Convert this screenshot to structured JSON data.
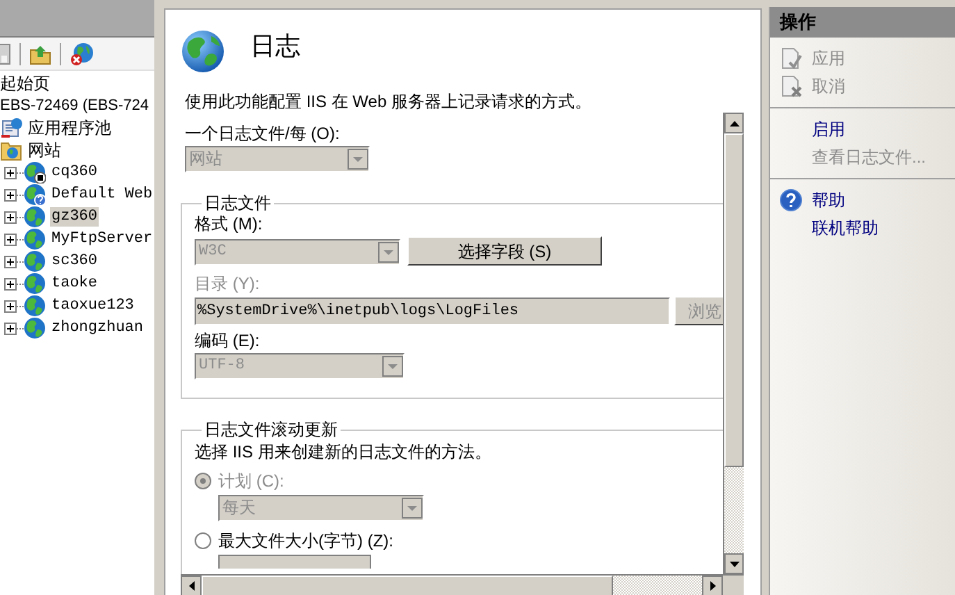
{
  "tree": [
    {
      "label": "起始页",
      "kind": "start",
      "selected": false
    },
    {
      "label": "EBS-72469 (EBS-724",
      "kind": "server",
      "selected": false,
      "children": [
        {
          "label": "应用程序池",
          "kind": "app_pools",
          "selected": false
        },
        {
          "label": "网站",
          "kind": "sites",
          "selected": false,
          "children": [
            {
              "label": "cq360",
              "kind": "stopped_site",
              "expanded": false,
              "selected": false
            },
            {
              "label": "Default Web",
              "kind": "unknown_site",
              "expanded": false,
              "selected": false
            },
            {
              "label": "gz360",
              "kind": "site",
              "expanded": false,
              "selected": true
            },
            {
              "label": "MyFtpServer",
              "kind": "site",
              "expanded": false,
              "selected": false
            },
            {
              "label": "sc360",
              "kind": "site",
              "expanded": false,
              "selected": false
            },
            {
              "label": "taoke",
              "kind": "site",
              "expanded": false,
              "selected": false
            },
            {
              "label": "taoxue123",
              "kind": "site",
              "expanded": false,
              "selected": false
            },
            {
              "label": "zhongzhuan",
              "kind": "site",
              "expanded": false,
              "selected": false
            }
          ]
        }
      ]
    }
  ],
  "feature": {
    "title": "日志",
    "description": "使用此功能配置 IIS 在 Web 服务器上记录请求的方式。",
    "log_file_per": {
      "label": "一个日志文件/每 (O):",
      "value": "网站",
      "disabled": true
    },
    "log_file": {
      "title": "日志文件",
      "format": {
        "label": "格式 (M):",
        "value": "W3C",
        "disabled": true
      },
      "select_fields_button": "选择字段 (S)",
      "directory": {
        "label": "目录 (Y):",
        "value": "%SystemDrive%\\inetpub\\logs\\LogFiles",
        "disabled": true
      },
      "browse_button": "浏览",
      "encoding": {
        "label": "编码 (E):",
        "value": "UTF-8",
        "disabled": true
      }
    },
    "rollover": {
      "title": "日志文件滚动更新",
      "description": "选择 IIS 用来创建新的日志文件的方法。",
      "options": [
        {
          "label": "计划 (C):",
          "selected": true,
          "disabled": true,
          "dropdown": "每天"
        },
        {
          "label": "最大文件大小(字节) (Z):",
          "selected": false,
          "disabled": false
        }
      ]
    }
  },
  "actions": {
    "title": "操作",
    "groups": [
      [
        {
          "label": "应用",
          "kind": "apply",
          "disabled": true
        },
        {
          "label": "取消",
          "kind": "cancel",
          "disabled": true
        }
      ],
      [
        {
          "label": "启用",
          "kind": "link",
          "disabled": false
        },
        {
          "label": "查看日志文件...",
          "kind": "link",
          "disabled": true
        }
      ],
      [
        {
          "label": "帮助",
          "kind": "help",
          "disabled": false
        },
        {
          "label": "联机帮助",
          "kind": "link",
          "disabled": false
        }
      ]
    ]
  }
}
